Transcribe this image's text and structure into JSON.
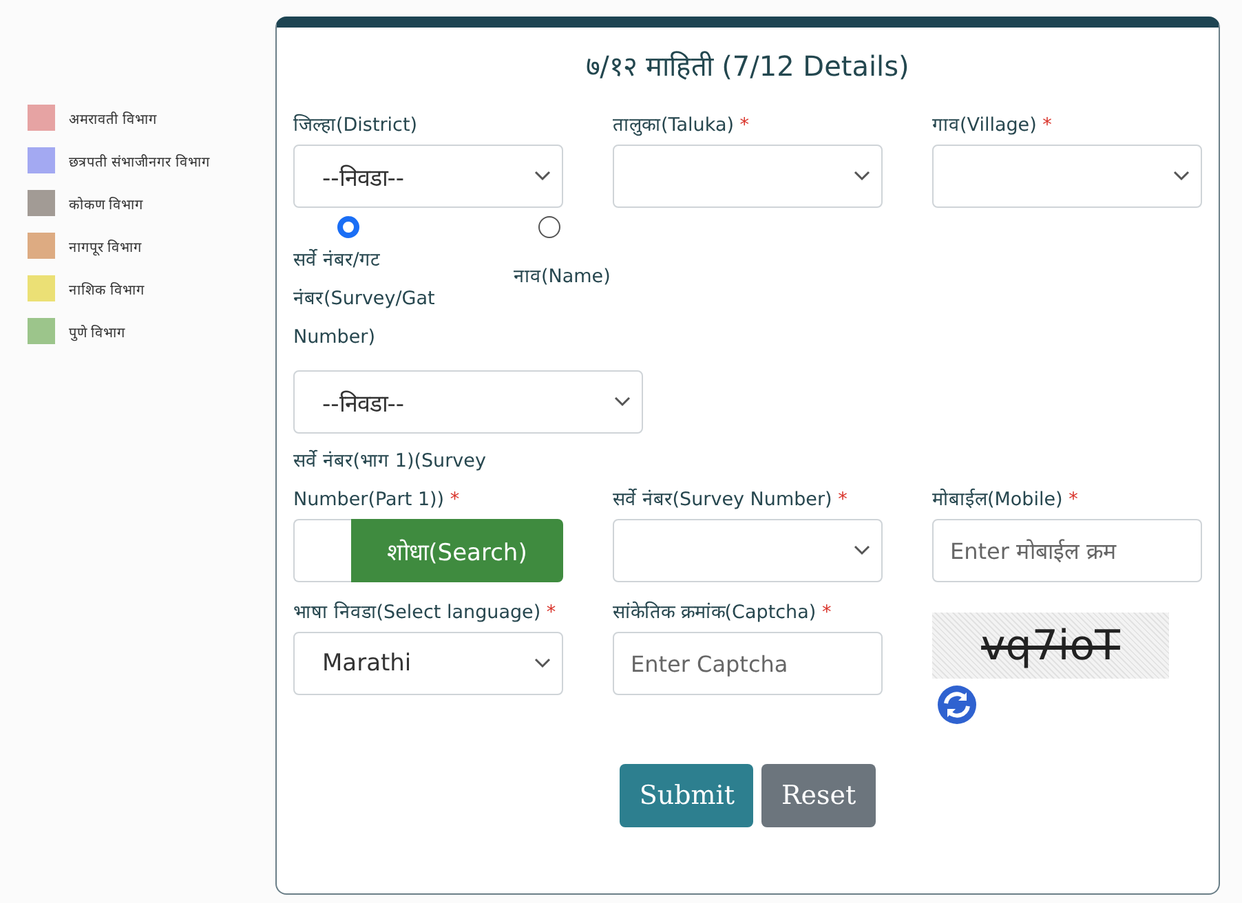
{
  "legend": [
    {
      "label": "अमरावती विभाग",
      "color": "#e6a3a3"
    },
    {
      "label": "छत्रपती संभाजीनगर विभाग",
      "color": "#a3a9f2"
    },
    {
      "label": "कोकण विभाग",
      "color": "#a29b95"
    },
    {
      "label": "नागपूर विभाग",
      "color": "#ddab82"
    },
    {
      "label": "नाशिक विभाग",
      "color": "#ebe075"
    },
    {
      "label": "पुणे विभाग",
      "color": "#9cc58b"
    }
  ],
  "card": {
    "title": "७/१२ माहिती (7/12 Details)"
  },
  "row_1": [
    {
      "kind": "select",
      "label": "जिल्हा(District)",
      "value": "--निवडा--"
    },
    {
      "kind": "select",
      "label": "तालुका(Taluka)",
      "required_mark": "*"
    },
    {
      "kind": "select",
      "label": "गाव(Village)",
      "required_mark": "*"
    }
  ],
  "search_by": [
    {
      "label": "सर्वे नंबर/गट नंबर(Survey/Gat Number)",
      "selected": true
    },
    {
      "label": "नाव(Name)",
      "selected": false
    }
  ],
  "search_by_select": {
    "value": "--निवडा--"
  },
  "row_2": [
    {
      "kind": "search",
      "label": "सर्वे नंबर(भाग 1)(Survey Number(Part 1))",
      "required_mark": "*",
      "button": "शोधा(Search)"
    },
    {
      "kind": "select",
      "label": "सर्वे नंबर(Survey Number)",
      "required_mark": "*"
    },
    {
      "kind": "input",
      "label": "मोबाईल(Mobile)",
      "required_mark": "*",
      "placeholder": "Enter मोबाईल क्रम"
    }
  ],
  "row_3": [
    {
      "kind": "select",
      "label": "भाषा निवडा(Select language)",
      "required_mark": "*",
      "value": "Marathi"
    },
    {
      "kind": "input",
      "label": "सांकेतिक क्रमांक(Captcha)",
      "required_mark": "*",
      "placeholder": "Enter Captcha"
    },
    {
      "kind": "captcha",
      "captcha_text": "vq7ioT"
    }
  ],
  "buttons": [
    {
      "label": "Submit",
      "kind": "primary"
    },
    {
      "label": "Reset",
      "kind": "secondary"
    }
  ]
}
